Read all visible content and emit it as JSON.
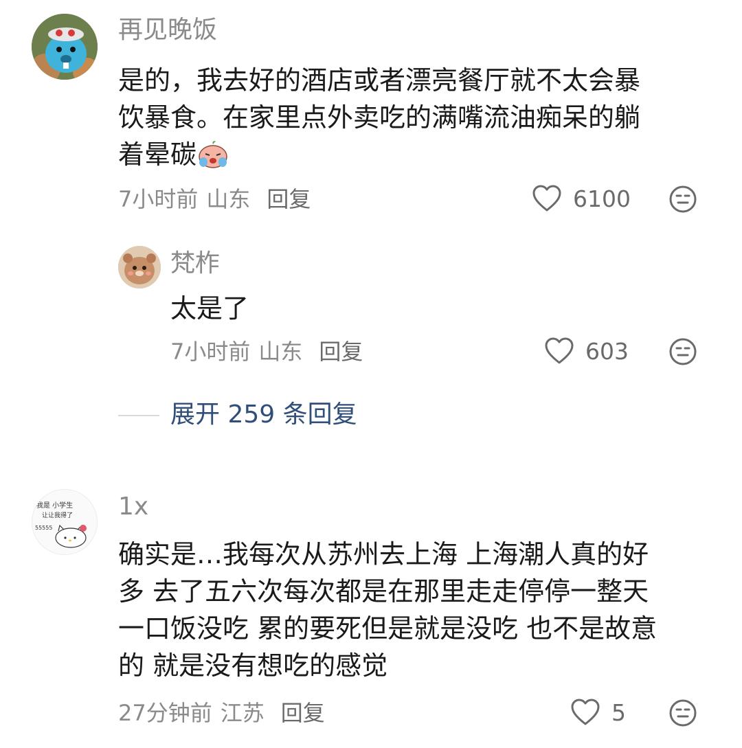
{
  "comments": [
    {
      "username": "再见晚饭",
      "lines": [
        "是的，我去好的酒店或者漂亮餐厅就不太会暴",
        "饮暴食。在家里点外卖吃的满嘴流油痴呆的躺",
        "着晕碳"
      ],
      "emoji": "crying-peach-emoji",
      "time": "7小时前",
      "location": "山东",
      "reply_label": "回复",
      "likes": "6100"
    },
    {
      "username": "梵柞",
      "lines": [
        "太是了"
      ],
      "time": "7小时前",
      "location": "山东",
      "reply_label": "回复",
      "likes": "603"
    },
    {
      "username": "1x",
      "avatar_text": [
        "我是 小学生",
        "让让我得了",
        "55555"
      ],
      "lines": [
        "确实是…我每次从苏州去上海 上海潮人真的好",
        "多 去了五六次每次都是在那里走走停停一整天",
        "一口饭没吃 累的要死但是就是没吃 也不是故意",
        "的 就是没有想吃的感觉"
      ],
      "time": "27分钟前",
      "location": "江苏",
      "reply_label": "回复",
      "likes": "5"
    }
  ],
  "expand_replies": "展开 259 条回复",
  "icons": {
    "like": "heart-outline-icon",
    "dislike": "neutral-face-icon"
  },
  "colors": {
    "text": "#1a1a1a",
    "meta": "#8a8a8a",
    "link": "#2f4e79"
  }
}
